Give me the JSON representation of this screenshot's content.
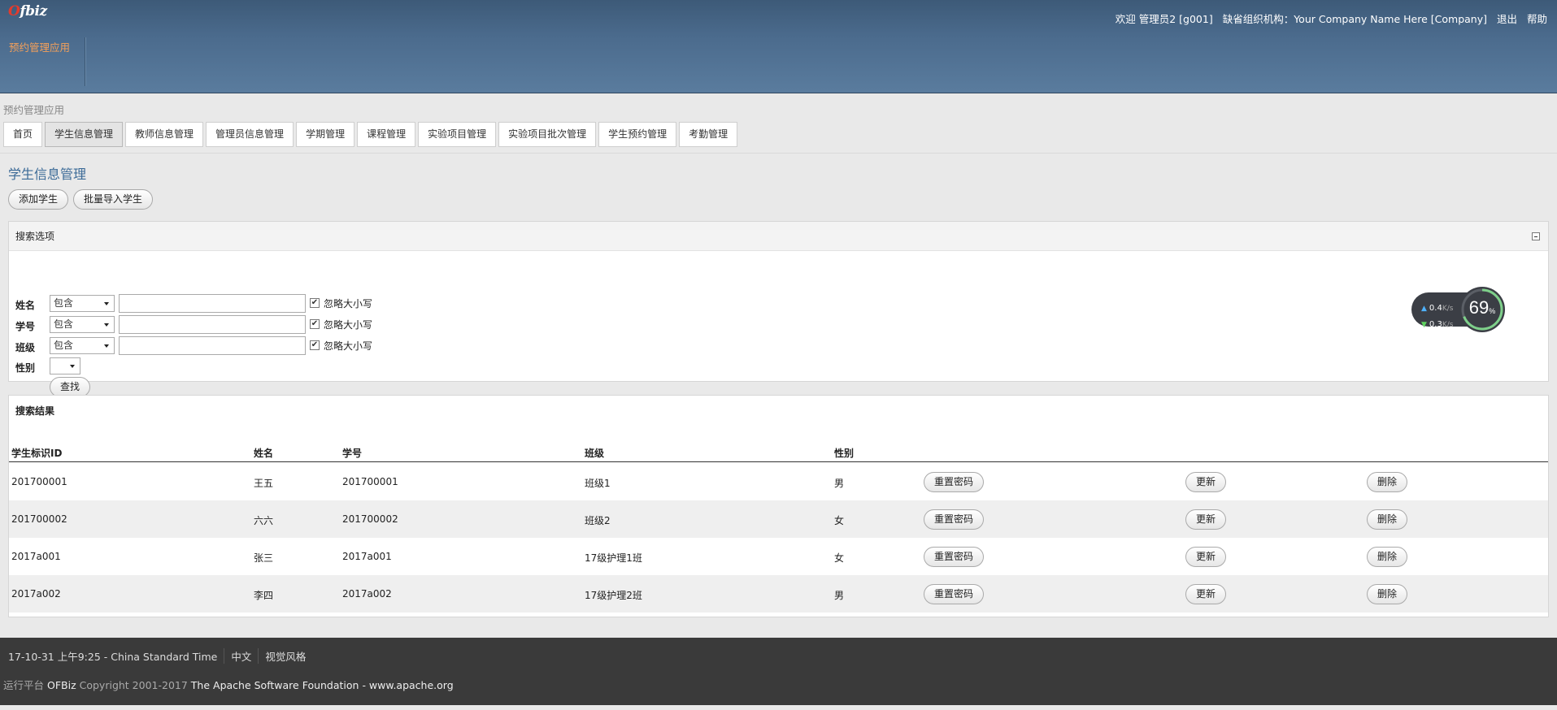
{
  "header": {
    "logo_o": "O",
    "logo_rest": "fbiz",
    "welcome": "欢迎 管理员2 [g001]",
    "org": "缺省组织机构：Your Company Name Here [Company]",
    "logout": "退出",
    "help": "帮助",
    "app_name": "预约管理应用"
  },
  "appbar": {
    "title": "预约管理应用",
    "tabs": [
      "首页",
      "学生信息管理",
      "教师信息管理",
      "管理员信息管理",
      "学期管理",
      "课程管理",
      "实验项目管理",
      "实验项目批次管理",
      "学生预约管理",
      "考勤管理"
    ],
    "active_tab": "学生信息管理"
  },
  "page": {
    "title": "学生信息管理",
    "add_button": "添加学生",
    "import_button": "批量导入学生"
  },
  "search": {
    "title": "搜索选项",
    "fields": [
      {
        "label": "姓名",
        "op": "包含",
        "ignore_case": "忽略大小写"
      },
      {
        "label": "学号",
        "op": "包含",
        "ignore_case": "忽略大小写"
      },
      {
        "label": "班级",
        "op": "包含",
        "ignore_case": "忽略大小写"
      }
    ],
    "gender_label": "性别",
    "submit": "查找"
  },
  "results": {
    "title": "搜索结果",
    "columns": [
      "学生标识ID",
      "姓名",
      "学号",
      "班级",
      "性别"
    ],
    "reset_label": "重置密码",
    "update_label": "更新",
    "delete_label": "删除",
    "rows": [
      {
        "id": "201700001",
        "name": "王五",
        "number": "201700001",
        "class": "班级1",
        "gender": "男"
      },
      {
        "id": "201700002",
        "name": "六六",
        "number": "201700002",
        "class": "班级2",
        "gender": "女"
      },
      {
        "id": "2017a001",
        "name": "张三",
        "number": "2017a001",
        "class": "17级护理1班",
        "gender": "女"
      },
      {
        "id": "2017a002",
        "name": "李四",
        "number": "2017a002",
        "class": "17级护理2班",
        "gender": "男"
      }
    ]
  },
  "net_widget": {
    "up": "0.4",
    "down": "0.3",
    "unit": "K/s",
    "percent": "69",
    "percent_sign": "%"
  },
  "footer": {
    "datetime": "17-10-31 上午9:25 - China Standard Time",
    "language": "中文",
    "theme": "视觉风格",
    "powered_prefix": "运行平台",
    "powered_name": "OFBiz",
    "copyright": "Copyright 2001-2017",
    "foundation": "The Apache Software Foundation - www.apache.org"
  },
  "colors": {
    "header": "#4b6b8d",
    "accent_title": "#3b6a97",
    "app_name": "#f4a05a",
    "footer": "#3a3a3a"
  }
}
